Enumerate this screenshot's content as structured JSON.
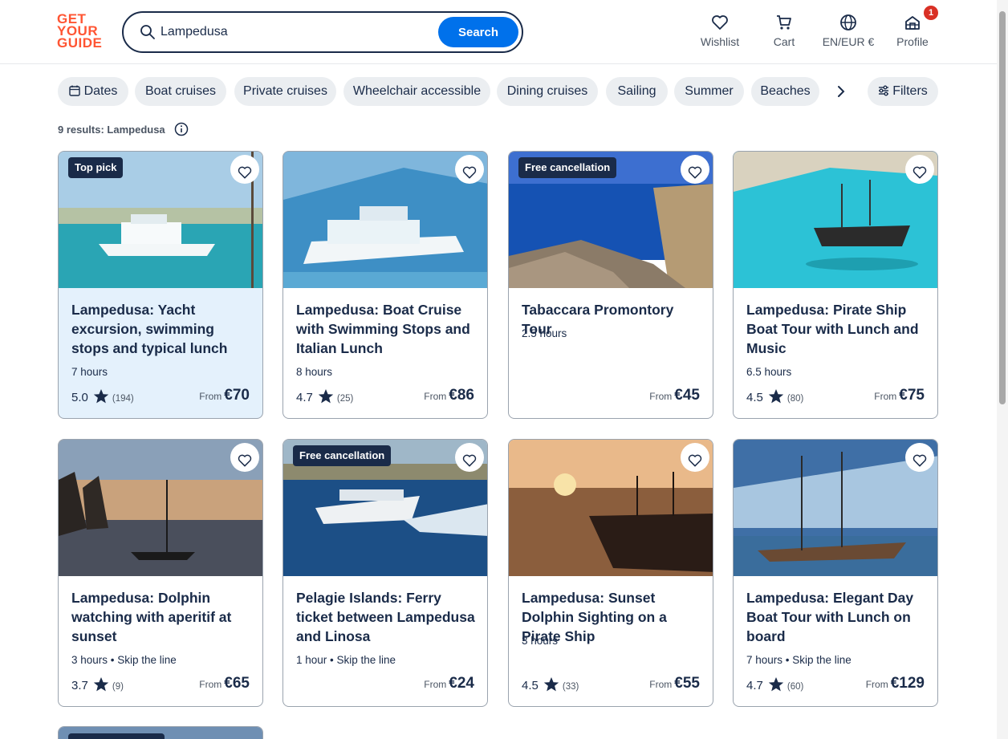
{
  "header": {
    "logo": [
      "GET",
      "YOUR",
      "GUIDE"
    ],
    "search_value": "Lampedusa",
    "search_button": "Search",
    "nav": [
      {
        "label": "Wishlist",
        "icon": "heart-icon"
      },
      {
        "label": "Cart",
        "icon": "cart-icon"
      },
      {
        "label": "EN/EUR €",
        "icon": "globe-icon"
      },
      {
        "label": "Profile",
        "icon": "profile-icon",
        "badge": "1"
      }
    ]
  },
  "chips": [
    {
      "label": "Dates",
      "icon": "calendar-icon"
    },
    {
      "label": "Boat cruises"
    },
    {
      "label": "Private cruises"
    },
    {
      "label": "Wheelchair accessible"
    },
    {
      "label": "Dining cruises"
    },
    {
      "label": "Sailing"
    },
    {
      "label": "Summer"
    },
    {
      "label": "Beaches"
    }
  ],
  "filters_label": "Filters",
  "results_text": "9 results: Lampedusa",
  "price_prefix": "From",
  "cards": [
    {
      "tag": "Top pick",
      "title": "Lampedusa: Yacht excursion, swimming stops and typical lunch",
      "meta": "7 hours",
      "rating": "5.0",
      "count": "(194)",
      "price": "€70"
    },
    {
      "tag": "",
      "title": "Lampedusa: Boat Cruise with Swimming Stops and Italian Lunch",
      "meta": "8 hours",
      "rating": "4.7",
      "count": "(25)",
      "price": "€86"
    },
    {
      "tag": "Free cancellation",
      "title": "Tabaccara Promontory Tour",
      "meta": "2.5 hours",
      "rating": "",
      "count": "",
      "price": "€45"
    },
    {
      "tag": "",
      "title": "Lampedusa: Pirate Ship Boat Tour with Lunch and Music",
      "meta": "6.5 hours",
      "rating": "4.5",
      "count": "(80)",
      "price": "€75"
    },
    {
      "tag": "",
      "title": "Lampedusa: Dolphin watching with aperitif at sunset",
      "meta": "3 hours • Skip the line",
      "rating": "3.7",
      "count": "(9)",
      "price": "€65"
    },
    {
      "tag": "Free cancellation",
      "title": "Pelagie Islands: Ferry ticket between Lampedusa and Linosa",
      "meta": "1 hour • Skip the line",
      "rating": "",
      "count": "",
      "price": "€24"
    },
    {
      "tag": "",
      "title": "Lampedusa: Sunset Dolphin Sighting on a Pirate Ship",
      "meta": "3 hours",
      "rating": "4.5",
      "count": "(33)",
      "price": "€55"
    },
    {
      "tag": "",
      "title": "Lampedusa: Elegant Day Boat Tour with Lunch on board",
      "meta": "7 hours • Skip the line",
      "rating": "4.7",
      "count": "(60)",
      "price": "€129"
    }
  ],
  "colors": {
    "brand": "#ff5533",
    "accent": "#0071eb",
    "navy": "#1a2b49",
    "badge": "#d93025"
  }
}
